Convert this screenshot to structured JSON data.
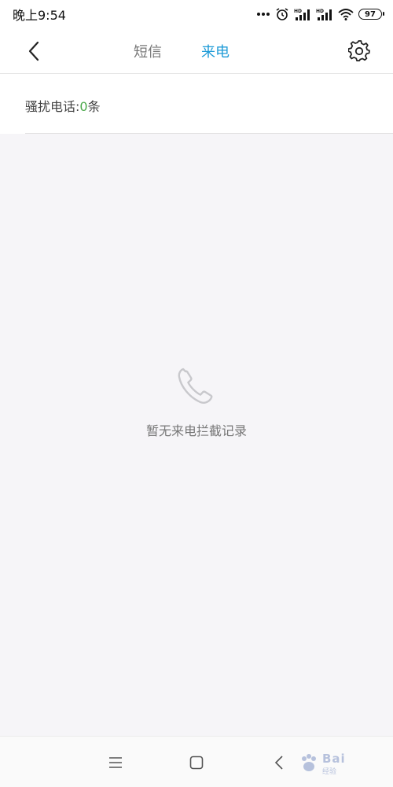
{
  "status_bar": {
    "time": "晚上9:54",
    "icons": [
      "more-dots-icon",
      "alarm-icon",
      "hd-signal-icon",
      "hd-signal-icon",
      "wifi-icon"
    ],
    "battery": "97"
  },
  "header": {
    "back_icon": "chevron-left-icon",
    "tabs": [
      {
        "label": "短信",
        "active": false
      },
      {
        "label": "来电",
        "active": true
      }
    ],
    "settings_icon": "gear-icon"
  },
  "summary": {
    "label": "骚扰电话:",
    "count": "0",
    "unit": "条"
  },
  "empty_state": {
    "icon": "phone-icon",
    "message": "暂无来电拦截记录"
  },
  "nav_bar": {
    "menu_icon": "menu-icon",
    "home_icon": "home-square-icon",
    "back_icon": "back-chevron-icon"
  },
  "watermark": {
    "text": "Bai",
    "sub": "经验"
  },
  "colors": {
    "accent": "#1e9bd7",
    "count_green": "#4aa84a",
    "background": "#f6f5f8"
  }
}
